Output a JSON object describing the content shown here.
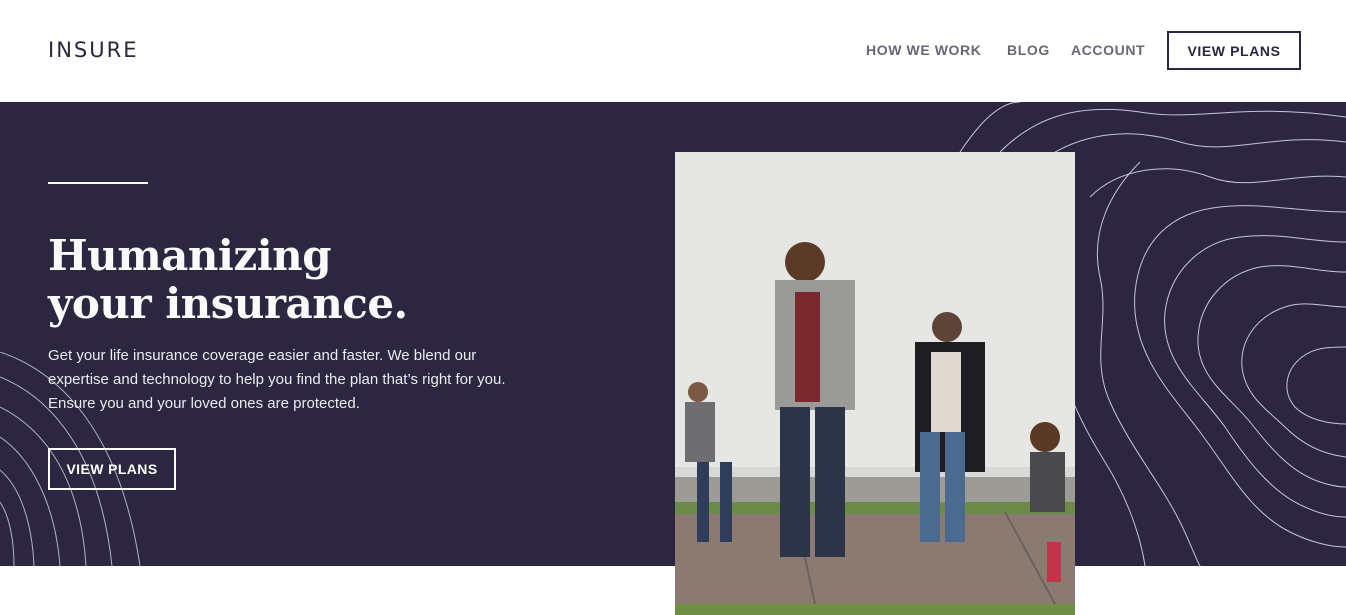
{
  "header": {
    "logo": "INSURE",
    "nav": {
      "how_we_work": "HOW WE WORK",
      "blog": "BLOG",
      "account": "ACCOUNT",
      "view_plans": "VIEW PLANS"
    }
  },
  "hero": {
    "title_line1": "Humanizing",
    "title_line2": "your insurance.",
    "description": "Get your life insurance coverage easier and faster. We blend our expertise and technology to help you find the plan that’s right for you. Ensure you and your loved ones are protected.",
    "cta_label": "VIEW PLANS"
  },
  "colors": {
    "dark_violet": "#2c2640",
    "white": "#ffffff",
    "nav_gray": "#6b6575"
  }
}
